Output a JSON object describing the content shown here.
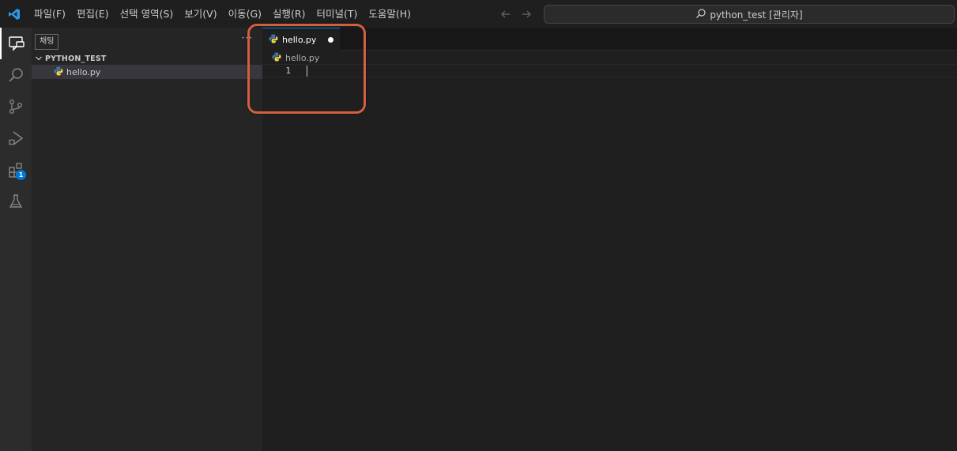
{
  "menu": {
    "items": [
      "파일(F)",
      "편집(E)",
      "선택 영역(S)",
      "보기(V)",
      "이동(G)",
      "실행(R)",
      "터미널(T)",
      "도움말(H)"
    ]
  },
  "command_center": {
    "text": "python_test [관리자]"
  },
  "activity_bar": {
    "items": [
      "explorer-chat",
      "search",
      "source-control",
      "run-debug",
      "extensions",
      "testing"
    ],
    "extensions_badge": "1"
  },
  "sidebar": {
    "tooltip": "채팅",
    "more_actions": "···",
    "folder_name": "PYTHON_TEST",
    "files": [
      "hello.py"
    ]
  },
  "editor": {
    "tab_label": "hello.py",
    "breadcrumb_file": "hello.py",
    "line_number": "1"
  },
  "colors": {
    "accent": "#0078d4",
    "highlight": "#d35f3f",
    "python_blue": "#3c78aa",
    "python_yellow": "#f7d34a"
  }
}
